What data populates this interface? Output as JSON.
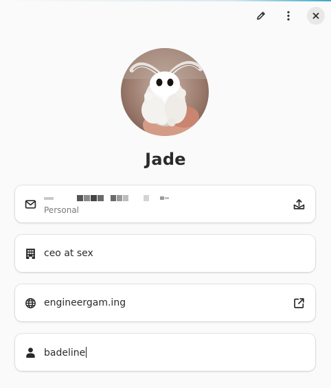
{
  "window": {
    "accent_color": "#3aa7c8",
    "header_buttons": [
      {
        "icon": "pencil-icon",
        "action": "edit"
      },
      {
        "icon": "vertical-dots-icon",
        "action": "menu"
      },
      {
        "icon": "close-icon",
        "action": "close"
      }
    ]
  },
  "contact": {
    "name": "Jade",
    "avatar": "moth-photo",
    "email": {
      "value": "",
      "label": "Personal",
      "icon": "mail-icon",
      "action_icon": "send-mail-icon"
    },
    "organization": {
      "value": "ceo at sex",
      "icon": "building-icon"
    },
    "website": {
      "value": "engineergam.ing",
      "icon": "globe-icon",
      "action_icon": "open-external-icon"
    },
    "nickname": {
      "value": "badeline",
      "icon": "person-icon"
    }
  }
}
